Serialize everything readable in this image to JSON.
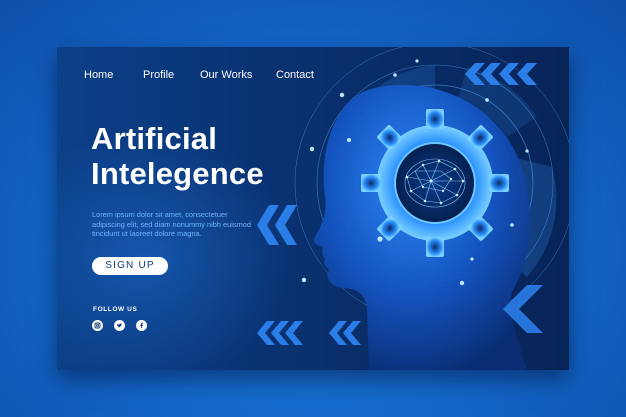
{
  "nav": {
    "items": [
      "Home",
      "Profile",
      "Our Works",
      "Contact"
    ]
  },
  "hero": {
    "title_line1": "Artificial",
    "title_line2": "Intelegence",
    "description": "Lorem ipsum dolor sit amet, consectetuer adipiscing elit, sed diam nonummy nibh euismod tincidunt ut laoreet dolore magna.",
    "cta_label": "SIGN UP"
  },
  "social": {
    "heading": "FOLLOW US",
    "icons": [
      "instagram-icon",
      "twitter-icon",
      "facebook-icon"
    ]
  },
  "colors": {
    "background": "#1366c8",
    "card": "#0a3170",
    "accent": "#3da0ff",
    "text": "#ffffff"
  }
}
